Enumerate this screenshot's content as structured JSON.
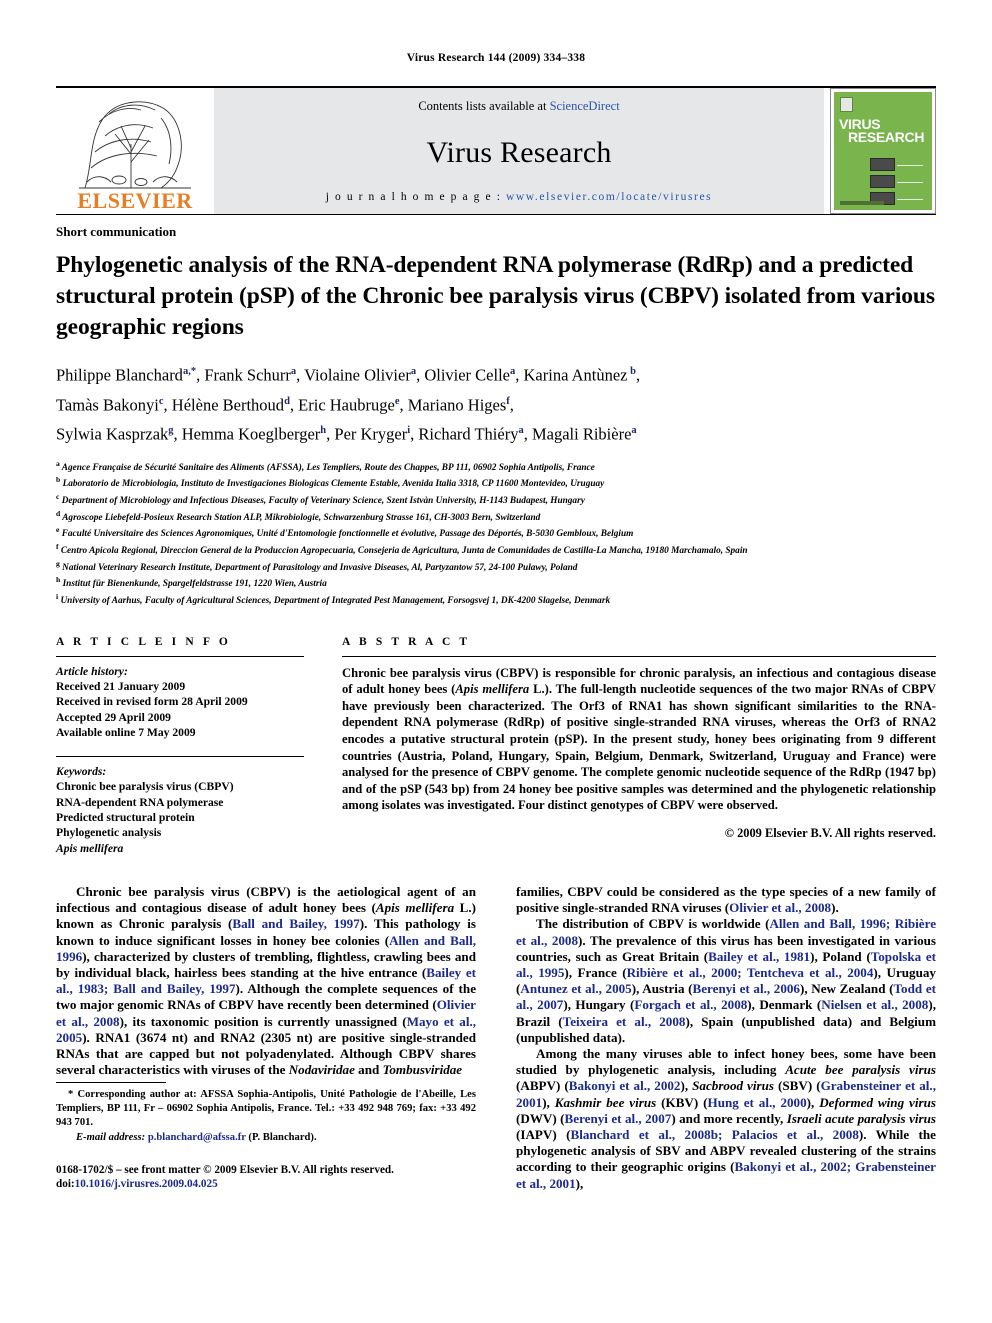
{
  "running_head": "Virus Research 144 (2009) 334–338",
  "masthead": {
    "publisher_name": "ELSEVIER",
    "contents_prefix": "Contents lists available at ",
    "contents_link": "ScienceDirect",
    "journal_title": "Virus Research",
    "homepage_prefix": "j o u r n a l   h o m e p a g e :  ",
    "homepage_url": "www.elsevier.com/locate/virusres",
    "cover_title_line1": "VIRUS",
    "cover_title_line2": "RESEARCH",
    "colors": {
      "elsevier_orange": "#E77E23",
      "link_blue": "#2b55a8",
      "band_gray": "#e6e7e8",
      "cover_green": "#79b44c"
    }
  },
  "article_type": "Short communication",
  "title": "Phylogenetic analysis of the RNA-dependent RNA polymerase (RdRp) and a predicted structural protein (pSP) of the Chronic bee paralysis virus (CBPV) isolated from various geographic regions",
  "authors_lines": [
    "Philippe Blanchard a,*, Frank Schurr a, Violaine Olivier a, Olivier Celle a, Karina Antùnez b,",
    "Tamàs Bakonyi c, Hélène Berthoud d, Eric Haubruge e, Mariano Higes f,",
    "Sylwia Kasprzak g, Hemma Koeglberger h, Per Kryger i, Richard Thiéry a, Magali Ribière a"
  ],
  "affiliations": [
    {
      "mark": "a",
      "text": "Agence Française de Sécurité Sanitaire des Aliments (AFSSA), Les Templiers, Route des Chappes, BP 111, 06902 Sophia Antipolis, France"
    },
    {
      "mark": "b",
      "text": "Laboratorio de Microbiologia, Instituto de Investigaciones Biologicas Clemente Estable, Avenida Italia 3318, CP 11600 Montevideo, Uruguay"
    },
    {
      "mark": "c",
      "text": "Department of Microbiology and Infectious Diseases, Faculty of Veterinary Science, Szent Istvàn University, H-1143 Budapest, Hungary"
    },
    {
      "mark": "d",
      "text": "Agroscope Liebefeld-Posieux Research Station ALP, Mikrobiologie, Schwarzenburg Strasse 161, CH-3003 Bern, Switzerland"
    },
    {
      "mark": "e",
      "text": "Faculté Universitaire des Sciences Agronomiques, Unité d'Entomologie fonctionnelle et évolutive, Passage des Déportés, B-5030 Gembloux, Belgium"
    },
    {
      "mark": "f",
      "text": "Centro Apicola Regional, Direccion General de la Produccion Agropecuaria, Consejeria de Agricultura, Junta de Comunidades de Castilla-La Mancha, 19180 Marchamalo, Spain"
    },
    {
      "mark": "g",
      "text": "National Veterinary Research Institute, Department of Parasitology and Invasive Diseases, Al, Partyzantow 57, 24-100 Pulawy, Poland"
    },
    {
      "mark": "h",
      "text": "Institut für Bienenkunde, Spargelfeldstrasse 191, 1220 Wien, Austria"
    },
    {
      "mark": "i",
      "text": "University of Aarhus, Faculty of Agricultural Sciences, Department of Integrated Pest Management, Forsogsvej 1, DK-4200 Slagelse, Denmark"
    }
  ],
  "article_info": {
    "heading": "A R T I C L E   I N F O",
    "history_label": "Article history:",
    "history": [
      "Received 21 January 2009",
      "Received in revised form 28 April 2009",
      "Accepted 29 April 2009",
      "Available online 7 May 2009"
    ],
    "keywords_label": "Keywords:",
    "keywords": [
      "Chronic bee paralysis virus (CBPV)",
      "RNA-dependent RNA polymerase",
      "Predicted structural protein",
      "Phylogenetic analysis",
      "Apis mellifera"
    ]
  },
  "abstract": {
    "heading": "A B S T R A C T",
    "text_part1": "Chronic bee paralysis virus (CBPV) is responsible for chronic paralysis, an infectious and contagious disease of adult honey bees (",
    "species_italic": "Apis mellifera",
    "text_part2": " L.). The full-length nucleotide sequences of the two major RNAs of CBPV have previously been characterized. The Orf3 of RNA1 has shown significant similarities to the RNA-dependent RNA polymerase (RdRp) of positive single-stranded RNA viruses, whereas the Orf3 of RNA2 encodes a putative structural protein (pSP). In the present study, honey bees originating from 9 different countries (Austria, Poland, Hungary, Spain, Belgium, Denmark, Switzerland, Uruguay and France) were analysed for the presence of CBPV genome. The complete genomic nucleotide sequence of the RdRp (1947 bp) and of the pSP (543 bp) from 24 honey bee positive samples was determined and the phylogenetic relationship among isolates was investigated. Four distinct genotypes of CBPV were observed.",
    "copyright": "© 2009 Elsevier B.V. All rights reserved."
  },
  "body": {
    "left_p1_a": "Chronic bee paralysis virus (CBPV) is the aetiological agent of an infectious and contagious disease of adult honey bees (",
    "left_p1_sp": "Apis mellifera",
    "left_p1_b": " L.) known as Chronic paralysis (",
    "left_p1_r1": "Ball and Bailey, 1997",
    "left_p1_c": "). This pathology is known to induce significant losses in honey bee colonies (",
    "left_p1_r2": "Allen and Ball, 1996",
    "left_p1_d": "), characterized by clusters of trembling, flightless, crawling bees and by individual black, hairless bees standing at the hive entrance (",
    "left_p1_r3": "Bailey et al., 1983; Ball and Bailey, 1997",
    "left_p1_e": "). Although the complete sequences of the two major genomic RNAs of CBPV have recently been determined (",
    "left_p1_r4": "Olivier et al., 2008",
    "left_p1_f": "), its taxonomic position is currently unassigned (",
    "left_p1_r5": "Mayo et al., 2005",
    "left_p1_g": "). RNA1 (3674 nt) and RNA2 (2305 nt) are positive single-stranded RNAs that are capped but not polyadenylated. Although CBPV shares several characteristics with viruses of the ",
    "left_p1_f1": "Nodaviridae",
    "left_p1_h": " and ",
    "left_p1_f2": "Tombusviridae",
    "right_p1_a": "families, CBPV could be considered as the type species of a new family of positive single-stranded RNA viruses (",
    "right_p1_r1": "Olivier et al., 2008",
    "right_p1_b": ").",
    "right_p2_a": "The distribution of CBPV is worldwide (",
    "right_p2_r1": "Allen and Ball, 1996; Ribière et al., 2008",
    "right_p2_b": "). The prevalence of this virus has been investigated in various countries, such as Great Britain (",
    "right_p2_r2": "Bailey et al., 1981",
    "right_p2_c": "), Poland (",
    "right_p2_r3": "Topolska et al., 1995",
    "right_p2_d": "), France (",
    "right_p2_r4": "Ribière et al., 2000; Tentcheva et al., 2004",
    "right_p2_e": "), Uruguay (",
    "right_p2_r5": "Antunez et al., 2005",
    "right_p2_f": "), Austria (",
    "right_p2_r6": "Berenyi et al., 2006",
    "right_p2_g": "), New Zealand (",
    "right_p2_r7": "Todd et al., 2007",
    "right_p2_h": "), Hungary (",
    "right_p2_r8": "Forgach et al., 2008",
    "right_p2_i": "), Denmark (",
    "right_p2_r9": "Nielsen et al., 2008",
    "right_p2_j": "), Brazil (",
    "right_p2_r10": "Teixeira et al., 2008",
    "right_p2_k": "), Spain (unpublished data) and Belgium (unpublished data).",
    "right_p3_a": "Among the many viruses able to infect honey bees, some have been studied by phylogenetic analysis, including ",
    "right_p3_i1": "Acute bee paralysis virus",
    "right_p3_b": " (ABPV) (",
    "right_p3_r1": "Bakonyi et al., 2002",
    "right_p3_c": "), ",
    "right_p3_i2": "Sacbrood virus",
    "right_p3_d": " (SBV) (",
    "right_p3_r2": "Grabensteiner et al., 2001",
    "right_p3_e": "), ",
    "right_p3_i3": "Kashmir bee virus",
    "right_p3_f": " (KBV) (",
    "right_p3_r3": "Hung et al., 2000",
    "right_p3_g": "), ",
    "right_p3_i4": "Deformed wing virus",
    "right_p3_h": " (DWV) (",
    "right_p3_r4": "Berenyi et al., 2007",
    "right_p3_i": ") and more recently, ",
    "right_p3_i5": "Israeli acute paralysis virus",
    "right_p3_j": " (IAPV) (",
    "right_p3_r5": "Blanchard et al., 2008b; Palacios et al., 2008",
    "right_p3_k": "). While the phylogenetic analysis of SBV and ABPV revealed clustering of the strains according to their geographic origins (",
    "right_p3_r6": "Bakonyi et al., 2002; Grabensteiner et al., 2001",
    "right_p3_l": "),"
  },
  "footnotes": {
    "corresponding": "* Corresponding author at: AFSSA Sophia-Antipolis, Unité Pathologie de l'Abeille, Les Templiers, BP 111, Fr – 06902 Sophia Antipolis, France. Tel.: +33 492 948 769; fax: +33 492 943 701.",
    "email_label": "E-mail address:",
    "email": "p.blanchard@afssa.fr",
    "email_suffix": " (P. Blanchard).",
    "issn_line": "0168-1702/$ – see front matter © 2009 Elsevier B.V. All rights reserved.",
    "doi_label": "doi:",
    "doi_value": "10.1016/j.virusres.2009.04.025"
  }
}
